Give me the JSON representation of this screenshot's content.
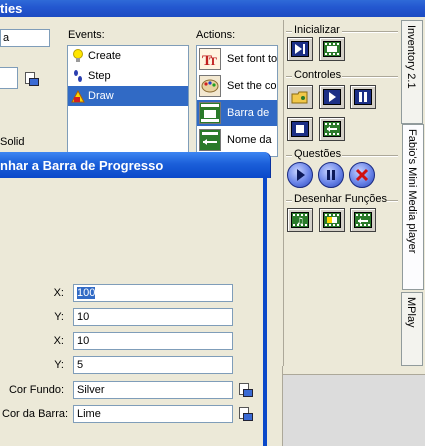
{
  "back_window": {
    "title_fragment": "ties",
    "name_field_value": "a",
    "solid_label": "Solid",
    "events_label": "Events:",
    "events": [
      "Create",
      "Step",
      "Draw"
    ],
    "selected_event_index": 2,
    "actions_label": "Actions:",
    "actions": [
      "Set font to",
      "Set the co",
      "Barra de",
      "Nome da"
    ],
    "selected_action_index": 2
  },
  "palette": {
    "groups": {
      "inicializar": "Inicializar",
      "controles": "Controles",
      "questoes": "Questões",
      "desenhar": "Desenhar Funções"
    }
  },
  "tabs": [
    "Inventory 2.1",
    "Fabio's Mini Media player",
    "MPlay"
  ],
  "active_tab_index": 1,
  "dialog": {
    "title": "nhar a Barra de Progresso",
    "fields": [
      {
        "label": "X:",
        "value": "100",
        "selected": true
      },
      {
        "label": "Y:",
        "value": "10"
      },
      {
        "label": "X:",
        "value": "10"
      },
      {
        "label": "Y:",
        "value": "5"
      },
      {
        "label": "Cor Fundo:",
        "value": "Silver"
      },
      {
        "label": "Cor da Barra:",
        "value": "Lime"
      }
    ]
  },
  "colors": {
    "titlebar": "#2458d0",
    "selection": "#316ac5",
    "dialog_title": "#1b5fd9"
  }
}
